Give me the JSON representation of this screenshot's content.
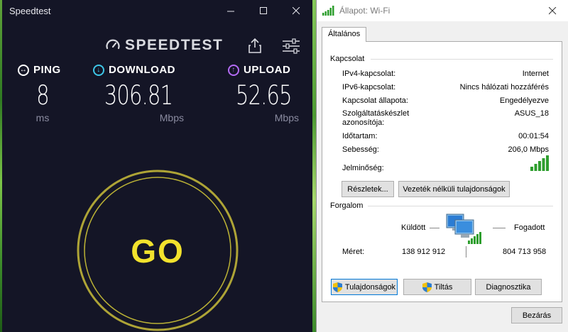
{
  "speedtest": {
    "window_title": "Speedtest",
    "logo_text": "SPEEDTEST",
    "ping": {
      "label": "PING",
      "value": "8",
      "unit": "ms",
      "color": "#ffffff"
    },
    "download": {
      "label": "DOWNLOAD",
      "value": "306.81",
      "unit": "Mbps",
      "color": "#3ec7e8"
    },
    "upload": {
      "label": "UPLOAD",
      "value": "52.65",
      "unit": "Mbps",
      "color": "#b46bf5"
    },
    "go_label": "GO",
    "go_color": "#f2e22d",
    "icons": [
      "speedometer-icon",
      "share-icon",
      "settings-sliders-icon",
      "minimize-icon",
      "maximize-icon",
      "close-icon"
    ]
  },
  "wifi_status": {
    "window_title": "Állapot: Wi-Fi",
    "tab": "Általános",
    "connection": {
      "group_title": "Kapcsolat",
      "rows": [
        {
          "label": "IPv4-kapcsolat:",
          "value": "Internet"
        },
        {
          "label": "IPv6-kapcsolat:",
          "value": "Nincs hálózati hozzáférés"
        },
        {
          "label": "Kapcsolat állapota:",
          "value": "Engedélyezve"
        },
        {
          "label": "Szolgáltatáskészlet azonosítója:",
          "label_line1": "Szolgáltatáskészlet",
          "label_line2": "azonosítója:",
          "value": "ASUS_18"
        },
        {
          "label": "Időtartam:",
          "value": "00:01:54"
        },
        {
          "label": "Sebesség:",
          "value": "206,0 Mbps"
        },
        {
          "label": "Jelminőség:",
          "value": ""
        }
      ],
      "signal_bars": 5,
      "details_button": "Részletek...",
      "wireless_props_button": "Vezeték nélküli tulajdonságok"
    },
    "activity": {
      "group_title": "Forgalom",
      "sent_label": "Küldött",
      "received_label": "Fogadott",
      "size_label": "Méret:",
      "sent_value": "138 912 912",
      "received_value": "804 713 958"
    },
    "buttons": {
      "properties": "Tulajdonságok",
      "disable": "Tiltás",
      "diagnose": "Diagnosztika",
      "close": "Bezárás"
    }
  }
}
